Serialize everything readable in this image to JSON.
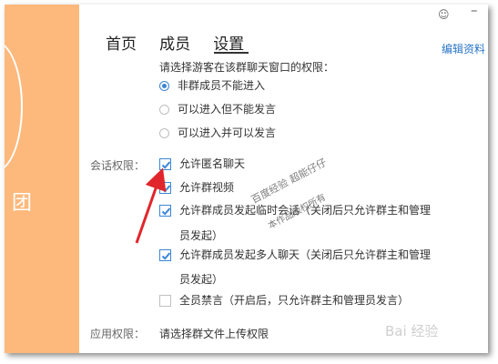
{
  "sidebar": {
    "fragment": "团"
  },
  "nav": {
    "tabs": [
      {
        "label": "首页"
      },
      {
        "label": "成员"
      },
      {
        "label": "设置"
      }
    ],
    "active": "设置"
  },
  "header": {
    "edit_link": "编辑资料"
  },
  "guest": {
    "prompt": "请选择游客在该群聊天窗口的权限：",
    "options": [
      {
        "label": "非群成员不能进入",
        "selected": true
      },
      {
        "label": "可以进入但不能发言",
        "selected": false
      },
      {
        "label": "可以进入并可以发言",
        "selected": false
      }
    ]
  },
  "session": {
    "label": "会话权限：",
    "items": [
      {
        "label": "允许匿名聊天",
        "checked": true
      },
      {
        "label": "允许群视频",
        "checked": true
      },
      {
        "label": "允许群成员发起临时会话（关闭后只允许群主和管理",
        "checked": true,
        "cont": "员发起）"
      },
      {
        "label": "允许群成员发起多人聊天（关闭后只允许群主和管理",
        "checked": true,
        "cont": "员发起）"
      },
      {
        "label": "全员禁言（开启后，只允许群主和管理员发言）",
        "checked": false
      }
    ]
  },
  "app": {
    "label": "应用权限：",
    "prompt": "请选择群文件上传权限"
  },
  "watermark": {
    "line1": "百度经验 超能仔仔",
    "line2": "本作品版权所有",
    "logo": "Bai 经验"
  },
  "colors": {
    "accent": "#3b86d6",
    "sidebar": "#fdb97c",
    "arrow": "#e0262c",
    "link": "#2a76c6"
  }
}
